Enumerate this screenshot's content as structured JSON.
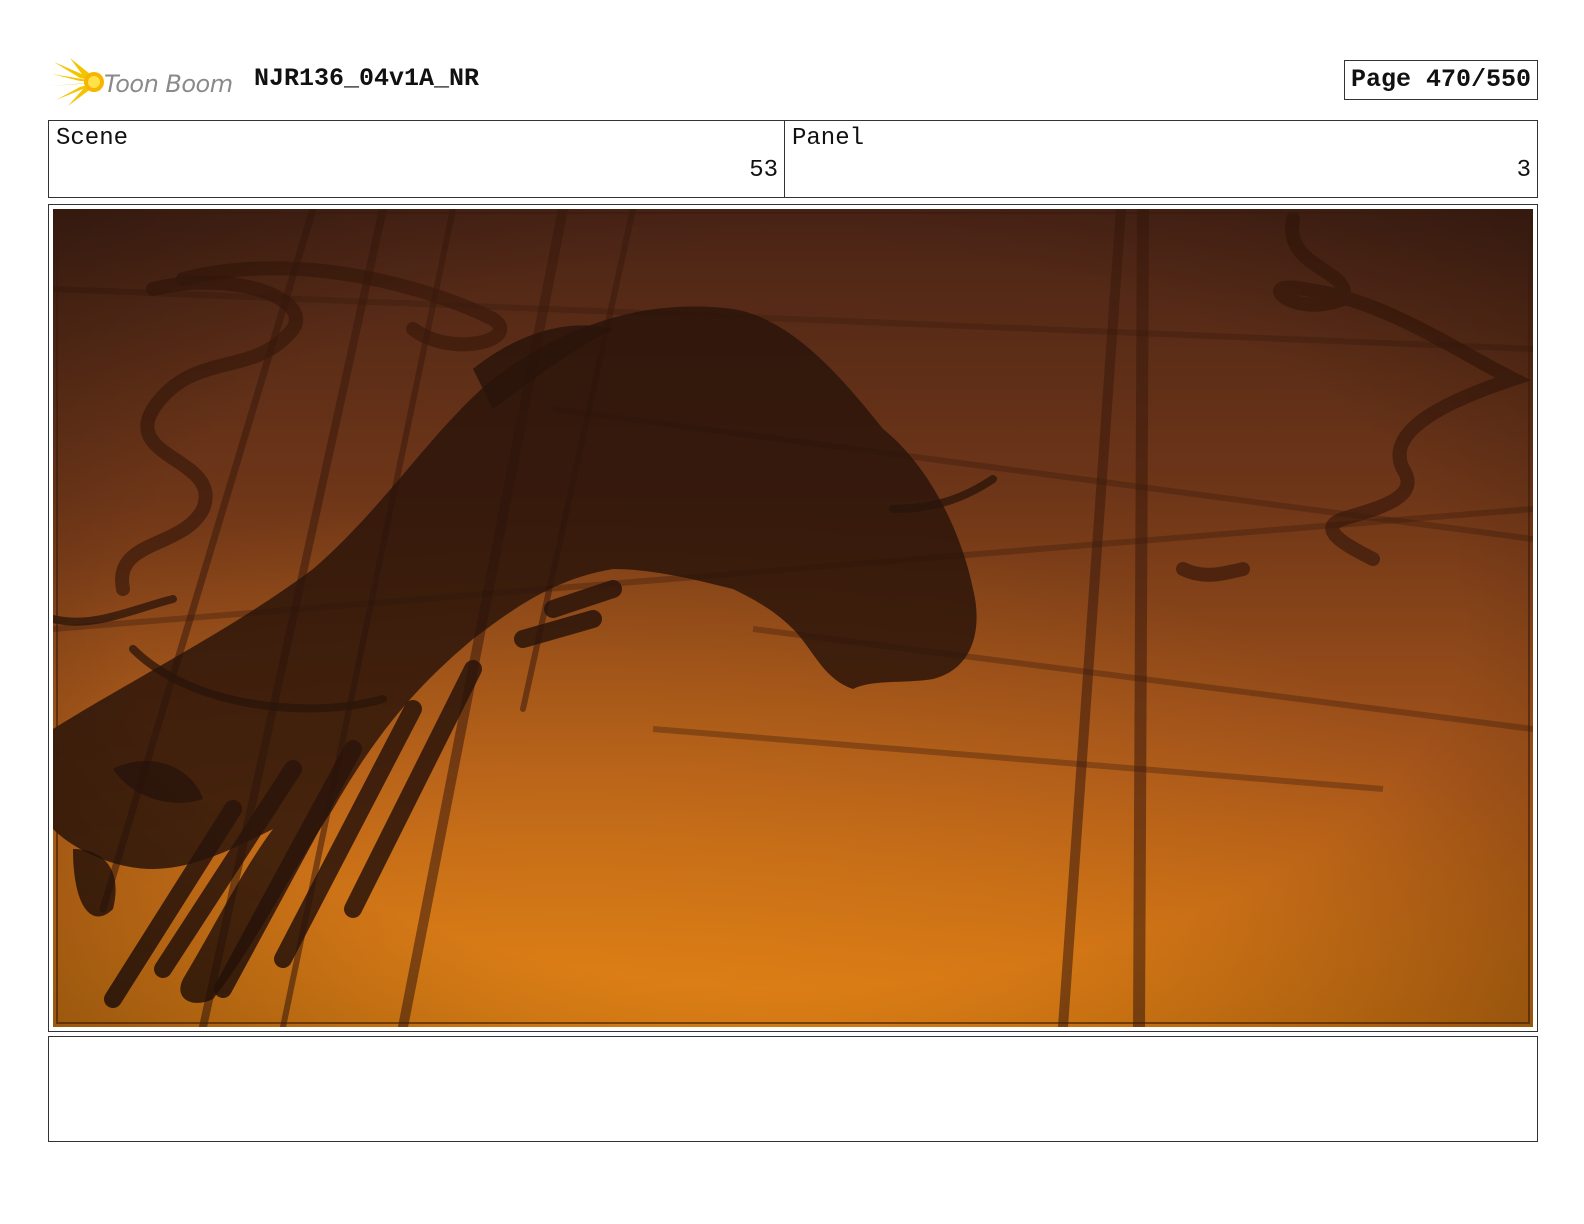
{
  "header": {
    "logo_text": "Toon Boom",
    "project_title": "NJR136_04v1A_NR",
    "page_label": "Page 470/550"
  },
  "info": {
    "scene_label": "Scene",
    "scene_value": "53",
    "panel_label": "Panel",
    "panel_value": "3"
  },
  "artwork": {
    "icon": "storyboard-panel-image",
    "colors": {
      "top": "#5a2a1a",
      "mid": "#8a4418",
      "bottom": "#d77410",
      "silhouette": "#2a140a"
    }
  },
  "notes": {
    "text": ""
  }
}
